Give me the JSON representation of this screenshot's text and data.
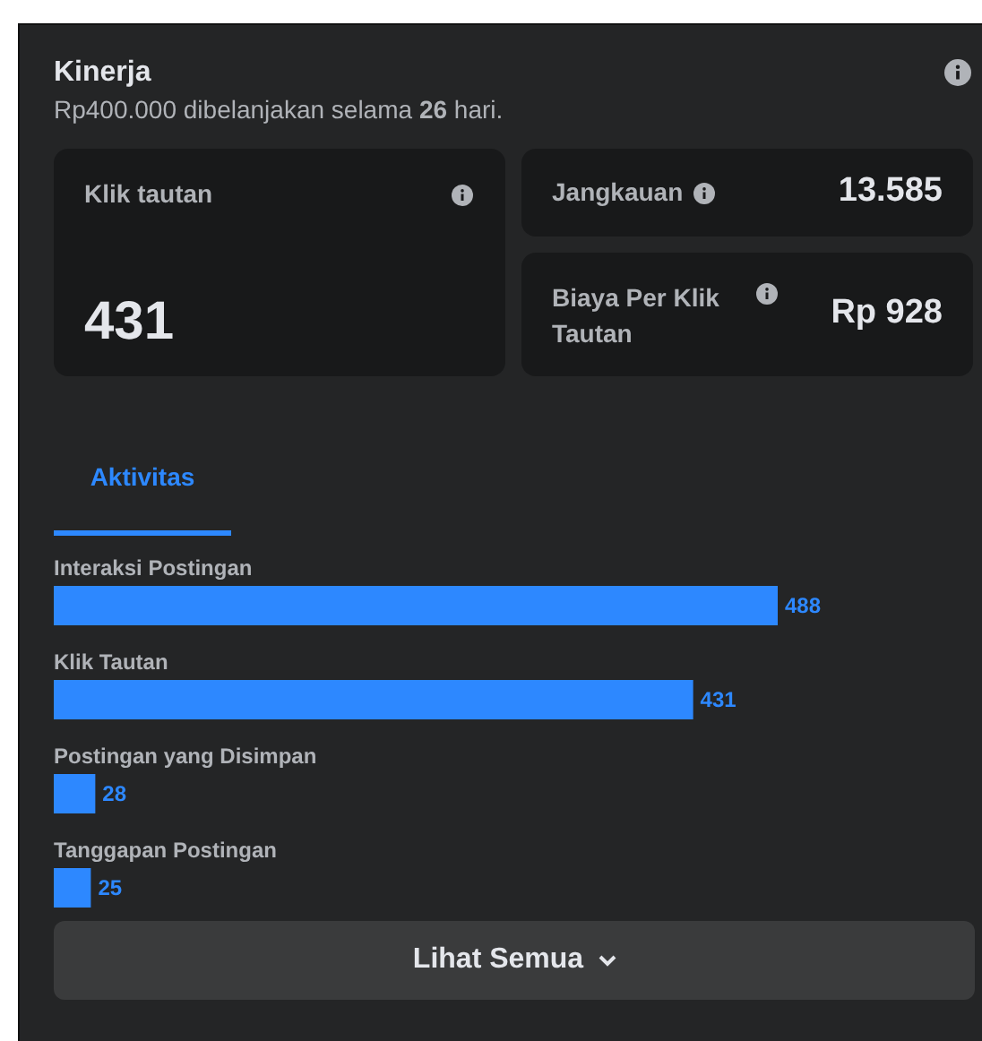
{
  "panel": {
    "title": "Kinerja",
    "subtitle": "Rp400.000 dibelanjakan selama **26** hari."
  },
  "metrics": [
    {
      "label": "Klik tautan",
      "value": "431"
    },
    {
      "label": "Jangkauan",
      "value": "13.585"
    },
    {
      "label": "Biaya Per Klik Tautan",
      "value": "Rp 928"
    }
  ],
  "tabs": [
    {
      "label": "Aktivitas",
      "selected": true
    }
  ],
  "activity": {
    "chart_data": {
      "type": "bar",
      "orientation": "horizontal",
      "categories": [
        "Interaksi Postingan",
        "Klik Tautan",
        "Postingan yang Disimpan",
        "Tanggapan Postingan"
      ],
      "series": [
        {
          "color": "#2d88ff",
          "values": [
            488,
            431,
            28,
            25
          ]
        }
      ],
      "data_labels": true
    }
  },
  "button": {
    "label": "Lihat Semua"
  }
}
